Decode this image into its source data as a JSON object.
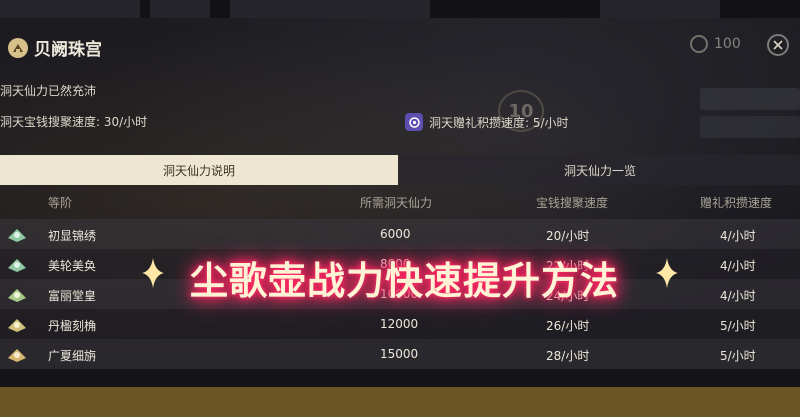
{
  "header": {
    "title": "贝阙珠宫",
    "currency_value": "100"
  },
  "status": {
    "energy_text": "洞天仙力已然充沛"
  },
  "stats": {
    "coin_rate": "洞天宝钱搜聚速度: 30/小时",
    "gift_rate": "洞天赠礼积攒速度: 5/小时"
  },
  "tabs": [
    {
      "label": "洞天仙力说明",
      "active": true
    },
    {
      "label": "洞天仙力一览",
      "active": false
    }
  ],
  "table": {
    "headers": [
      "等阶",
      "所需洞天仙力",
      "宝钱搜聚速度",
      "赠礼积攒速度"
    ],
    "rows": [
      {
        "name": "初显锦绣",
        "required": "6000",
        "coin_rate": "20/小时",
        "gift_rate": "4/小时"
      },
      {
        "name": "美轮美奂",
        "required": "8000",
        "coin_rate": "22/小时",
        "gift_rate": "4/小时"
      },
      {
        "name": "富丽堂皇",
        "required": "10000",
        "coin_rate": "24/小时",
        "gift_rate": "4/小时"
      },
      {
        "name": "丹楹刻桷",
        "required": "12000",
        "coin_rate": "26/小时",
        "gift_rate": "5/小时"
      },
      {
        "name": "广夏细旃",
        "required": "15000",
        "coin_rate": "28/小时",
        "gift_rate": "5/小时"
      }
    ]
  },
  "overlay": {
    "headline": "尘歌壶战力快速提升方法"
  },
  "colors": {
    "active_tab_bg": "#efe6d2",
    "highlight_row": "#6b5524",
    "glow": "#ff1f5a",
    "gift_icon": "#5d4fb0"
  },
  "icons": [
    "realm-icon",
    "coin-icon",
    "close-icon",
    "gift-icon",
    "sparkle-icon",
    "tier-icon"
  ]
}
